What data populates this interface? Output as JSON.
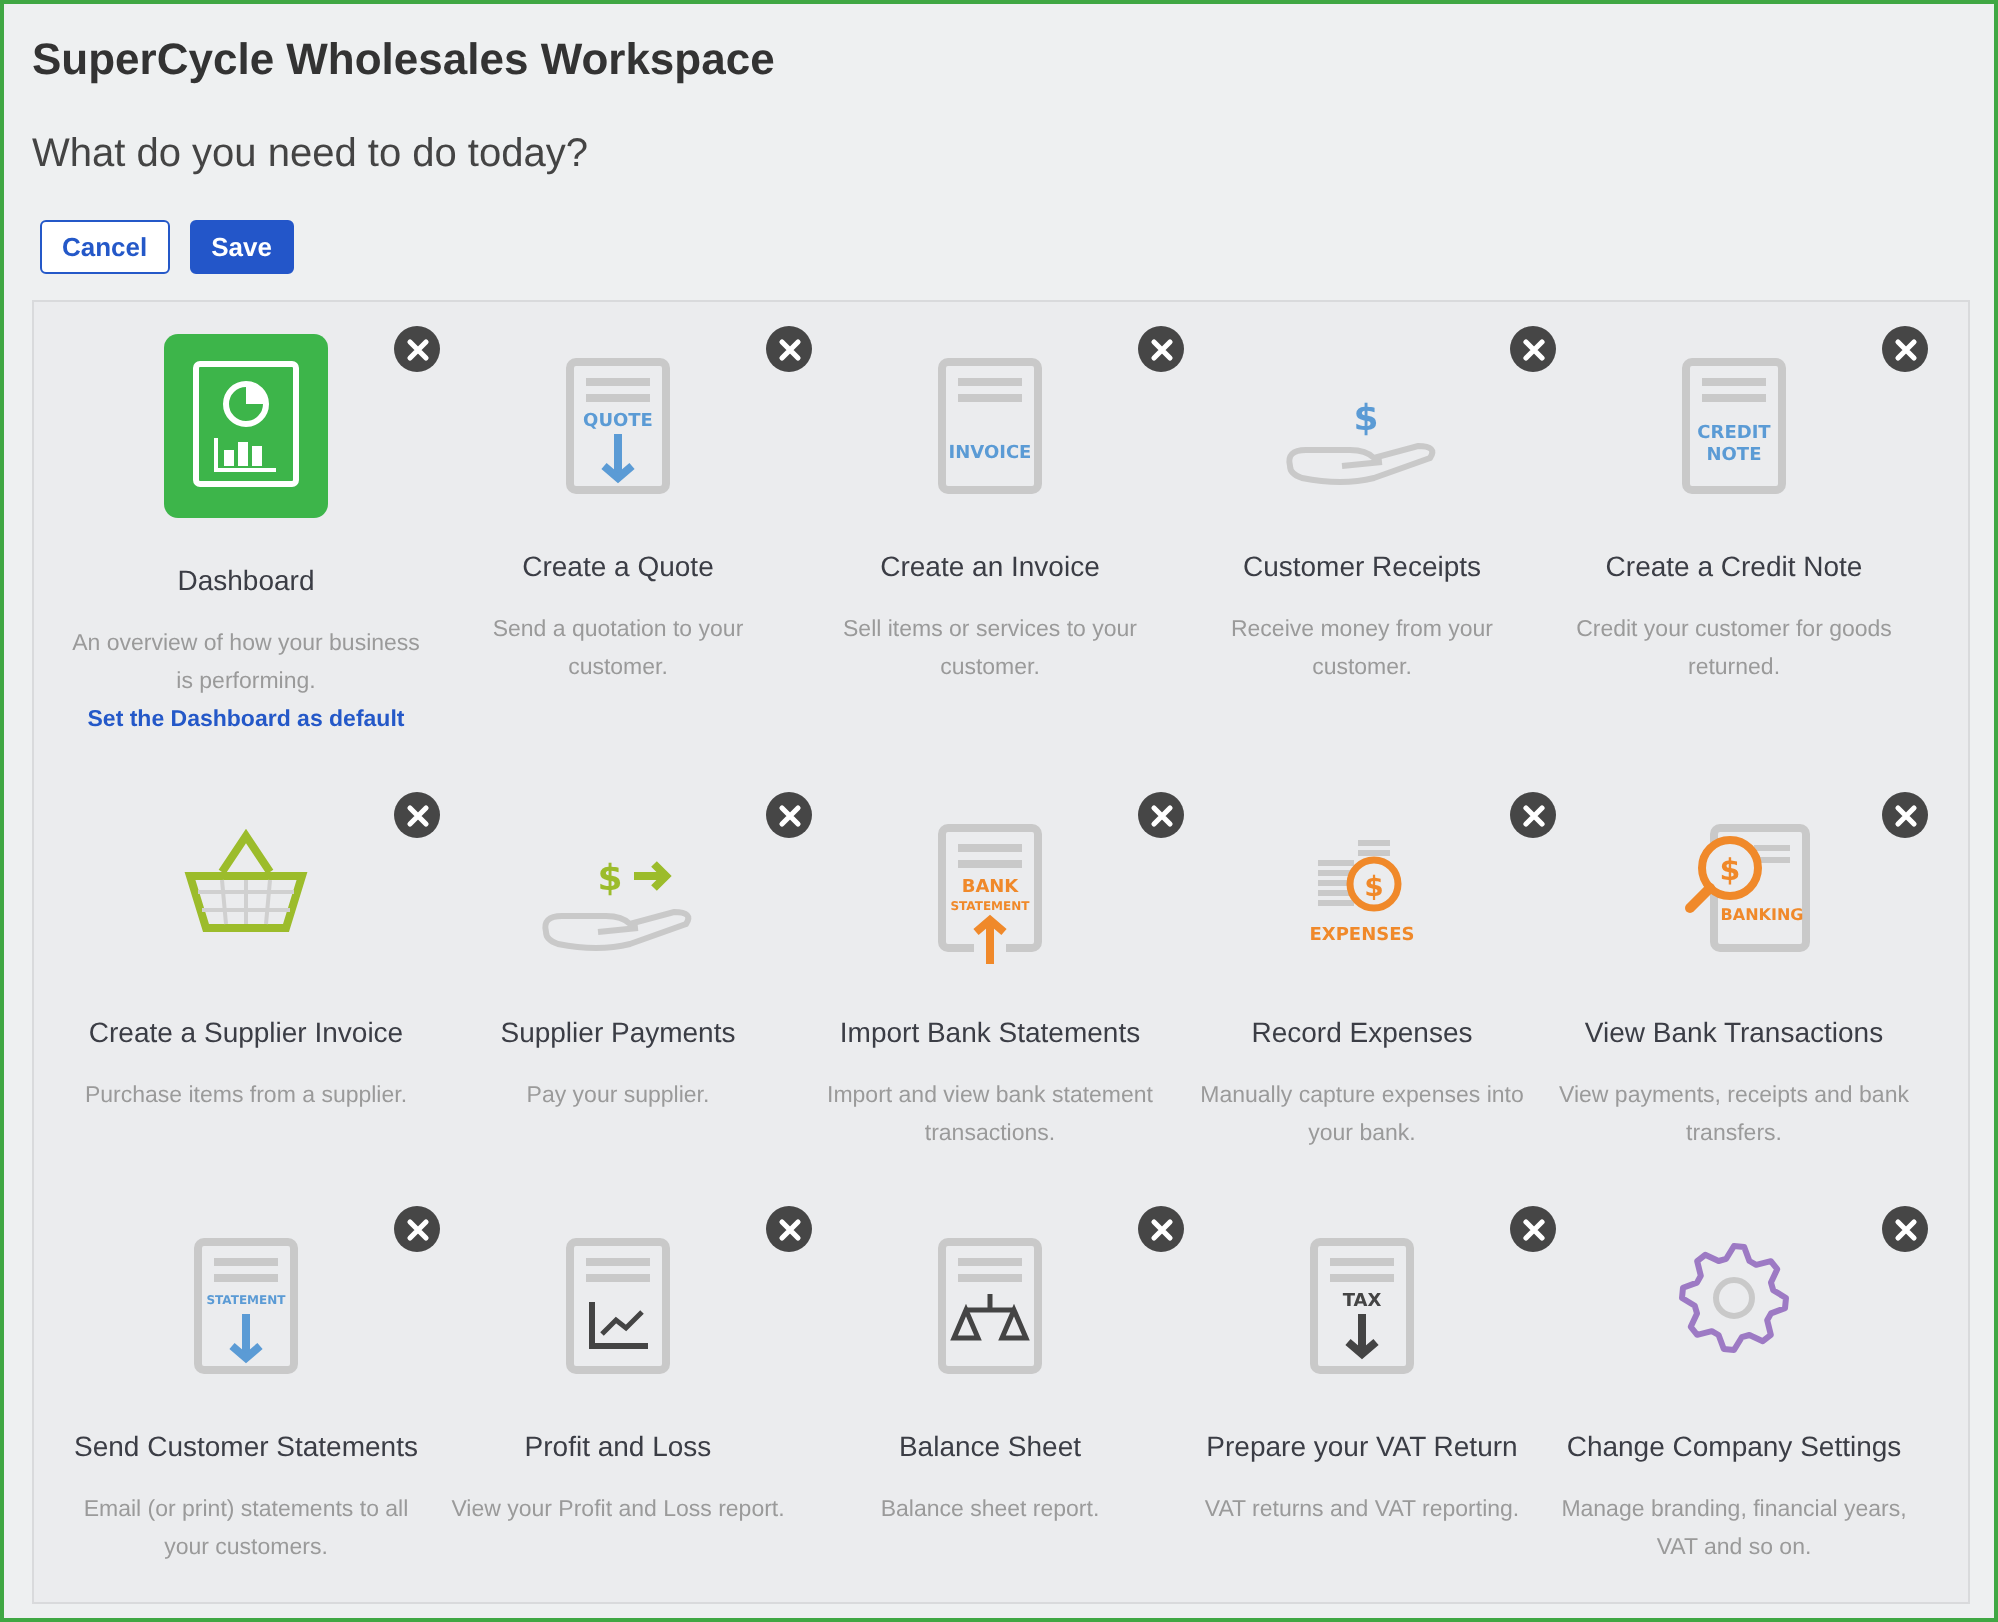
{
  "title": "SuperCycle Wholesales Workspace",
  "subtitle": "What do you need to do today?",
  "buttons": [
    {
      "kind": "secondary",
      "label": "Cancel"
    },
    {
      "kind": "primary",
      "label": "Save"
    }
  ],
  "tiles": [
    {
      "kind": "dashboard",
      "title": "Dashboard",
      "description": "An overview of how your business is performing.",
      "link": "Set the Dashboard as default"
    },
    {
      "kind": "quote",
      "icon_text": [
        "QUOTE"
      ],
      "title": "Create a Quote",
      "description": "Send a quotation to your customer."
    },
    {
      "kind": "invoice",
      "icon_text": [
        "INVOICE"
      ],
      "title": "Create an Invoice",
      "description": "Sell items or services to your customer."
    },
    {
      "kind": "receipt",
      "icon_text": [
        "$"
      ],
      "title": "Customer Receipts",
      "description": "Receive money from your customer."
    },
    {
      "kind": "credit",
      "icon_text": [
        "CREDIT",
        "NOTE"
      ],
      "title": "Create a Credit Note",
      "description": "Credit your customer for goods returned."
    },
    {
      "kind": "purchase",
      "title": "Create a Supplier Invoice",
      "description": "Purchase items from a supplier."
    },
    {
      "kind": "payment",
      "icon_text": [
        "$"
      ],
      "title": "Supplier Payments",
      "description": "Pay your supplier."
    },
    {
      "kind": "import",
      "icon_text": [
        "BANK",
        "STATEMENT"
      ],
      "title": "Import Bank Statements",
      "description": "Import and view bank statement transactions."
    },
    {
      "kind": "expenses",
      "icon_text": [
        "$",
        "EXPENSES"
      ],
      "title": "Record Expenses",
      "description": "Manually capture expenses into your bank."
    },
    {
      "kind": "banking",
      "icon_text": [
        "$",
        "BANKING"
      ],
      "title": "View Bank Transactions",
      "description": "View payments, receipts and bank transfers."
    },
    {
      "kind": "statement",
      "icon_text": [
        "STATEMENT"
      ],
      "title": "Send Customer Statements",
      "description": "Email (or print) statements to all your customers."
    },
    {
      "kind": "report",
      "title": "Profit and Loss",
      "description": "View your Profit and Loss report."
    },
    {
      "kind": "balance",
      "title": "Balance Sheet",
      "description": "Balance sheet report."
    },
    {
      "kind": "tax",
      "icon_text": [
        "TAX"
      ],
      "title": "Prepare your VAT Return",
      "description": "VAT returns and VAT reporting."
    },
    {
      "kind": "settings",
      "title": "Change Company Settings",
      "description": "Manage branding, financial years, VAT and so on."
    }
  ]
}
